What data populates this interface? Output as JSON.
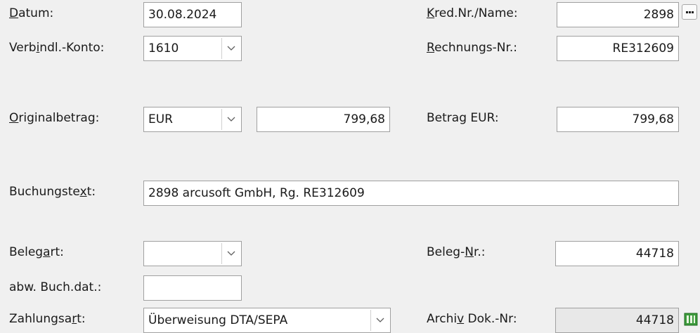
{
  "datum": {
    "label_pre": "",
    "label_u": "D",
    "label_post": "atum:",
    "value": "30.08.2024"
  },
  "kreditor": {
    "label_pre": "",
    "label_u": "K",
    "label_post": "red.Nr./Name:",
    "value": "2898"
  },
  "verbindl_konto": {
    "label_pre": "Verb",
    "label_u": "i",
    "label_post": "ndl.-Konto:",
    "value": "1610"
  },
  "rechnungs_nr": {
    "label_pre": "",
    "label_u": "R",
    "label_post": "echnungs-Nr.:",
    "value": "RE312609"
  },
  "originalbetrag": {
    "label_pre": "",
    "label_u": "O",
    "label_post": "riginalbetrag:",
    "currency": "EUR",
    "amount": "799,68"
  },
  "betrag_eur": {
    "label": "Betrag EUR:",
    "value": "799,68"
  },
  "buchungstext": {
    "label_pre": "Buchungste",
    "label_u": "x",
    "label_post": "t:",
    "value": "2898 arcusoft GmbH, Rg. RE312609"
  },
  "belegart": {
    "label_pre": "Beleg",
    "label_u": "a",
    "label_post": "rt:",
    "value": ""
  },
  "beleg_nr": {
    "label_pre": "Beleg-",
    "label_u": "N",
    "label_post": "r.:",
    "value": "44718"
  },
  "abw_buch_dat": {
    "label": "abw. Buch.dat.:",
    "value": ""
  },
  "zahlungsart": {
    "label_pre": "Zahlungsa",
    "label_u": "r",
    "label_post": "t:",
    "value": "Überweisung DTA/SEPA"
  },
  "archiv_dok_nr": {
    "label_pre": "Archi",
    "label_u": "v",
    "label_post": " Dok.-Nr:",
    "value": "44718"
  },
  "icons": {
    "lookup": "ellipsis-icon",
    "archive": "archive-document-icon"
  },
  "colors": {
    "background": "#f0f0f0",
    "field": "#ffffff",
    "readonly_field": "#e8e8e8",
    "archive_icon": "#3c9a3c"
  }
}
